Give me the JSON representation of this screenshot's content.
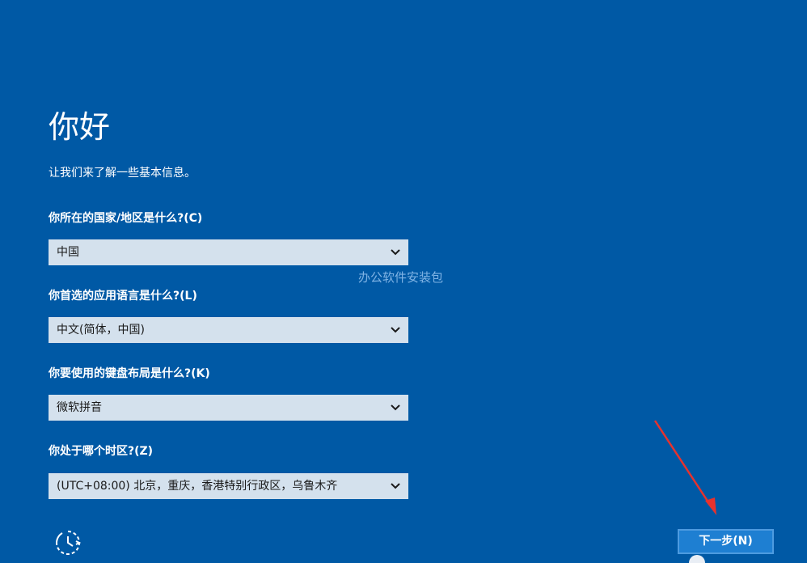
{
  "header": {
    "title": "你好",
    "subtitle": "让我们来了解一些基本信息。"
  },
  "questions": [
    {
      "label": "你所在的国家/地区是什么?(C)",
      "value": "中国"
    },
    {
      "label": "你首选的应用语言是什么?(L)",
      "value": "中文(简体，中国)"
    },
    {
      "label": "你要使用的键盘布局是什么?(K)",
      "value": "微软拼音"
    },
    {
      "label": "你处于哪个时区?(Z)",
      "value": "(UTC+08:00) 北京，重庆，香港特别行政区，乌鲁木齐"
    }
  ],
  "watermark": "办公软件安装包",
  "footer": {
    "accessibility_icon": "accessibility-icon",
    "next_label": "下一步(N)"
  },
  "annotation": {
    "arrow_color": "#e8322d"
  },
  "colors": {
    "background": "#0059a5",
    "select_bg": "#d4e1ed",
    "button_bg": "#1e7fd2"
  }
}
